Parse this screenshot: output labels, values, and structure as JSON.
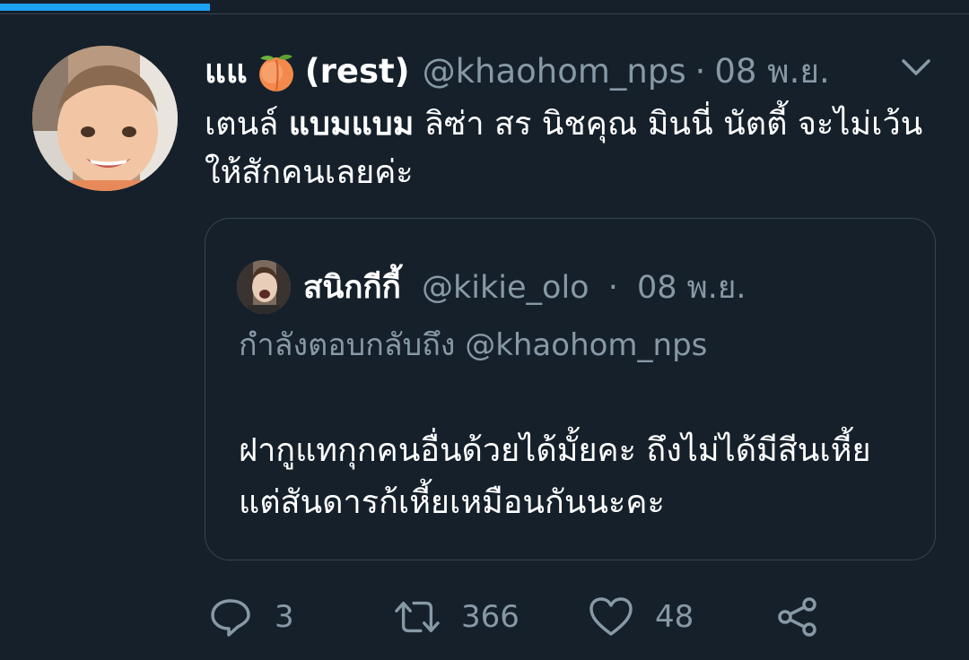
{
  "progress": {
    "fraction": 0.217,
    "color": "#1da1f2"
  },
  "tweet": {
    "display_name": "แแ",
    "display_name_suffix": "(rest)",
    "name_emoji": "peach-emoji",
    "handle": "@khaohom_nps",
    "separator": "·",
    "time": "08 พ.ย.",
    "text_part1": "เตนล์ ",
    "text_bold": "แบมแบม",
    "text_part2": " ลิซ่า สร นิชคุณ มินนี่ นัตตี้ จะไม่เว้นให้สักคนเลยค่ะ"
  },
  "quoted": {
    "display_name": "สนิกกีกี้",
    "handle": "@kikie_olo",
    "separator": "·",
    "time": "08 พ.ย.",
    "replying_to": "กำลังตอบกลับถึง @khaohom_nps",
    "text": "ฝากูแทกุกคนอื่นด้วยได้มั้ยคะ ถึงไม่ได้มีสีนเหี้ย แต่สันดารก้เหี้ยเหมือนกันนะคะ"
  },
  "actions": {
    "reply_icon": "reply-icon",
    "reply_count": "3",
    "retweet_icon": "retweet-icon",
    "retweet_count": "366",
    "like_icon": "heart-icon",
    "like_count": "48",
    "share_icon": "share-icon"
  },
  "colors": {
    "background": "#15202b",
    "secondary_text": "#8899a6",
    "border": "#38444d",
    "accent": "#1da1f2"
  }
}
